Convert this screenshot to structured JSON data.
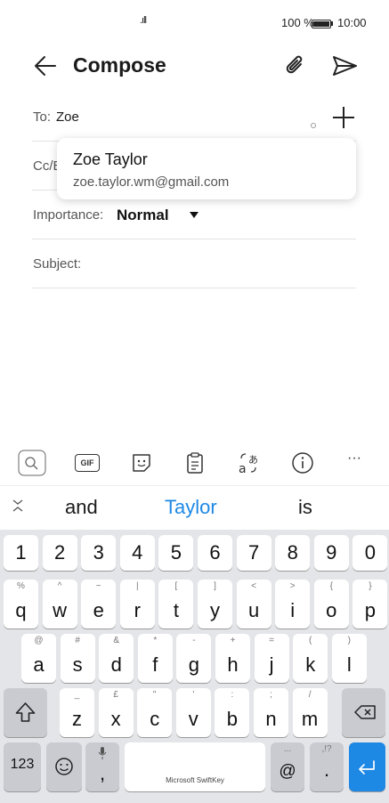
{
  "status_bar": {
    "signal": ".ıll",
    "battery": "100 %",
    "time": "10:00"
  },
  "header": {
    "title": "Compose"
  },
  "to": {
    "label": "To:",
    "value": "Zoe"
  },
  "cc": {
    "label": "Cc/B"
  },
  "importance": {
    "label": "Importance:",
    "value": "Normal"
  },
  "subject": {
    "label": "Subject:"
  },
  "suggestion": {
    "name": "Zoe Taylor",
    "email": "zoe.taylor.wm@gmail.com"
  },
  "keyboard_toolbar": {
    "gif": "GIF",
    "more": "···"
  },
  "predictions": {
    "left": "and",
    "center": "Taylor",
    "right": "is",
    "collapse": "⌄"
  },
  "keyboard": {
    "row_numbers": [
      "1",
      "2",
      "3",
      "4",
      "5",
      "6",
      "7",
      "8",
      "9",
      "0"
    ],
    "row_q": [
      {
        "k": "q",
        "s": "%"
      },
      {
        "k": "w",
        "s": "^"
      },
      {
        "k": "e",
        "s": "~"
      },
      {
        "k": "r",
        "s": "|"
      },
      {
        "k": "t",
        "s": "["
      },
      {
        "k": "y",
        "s": "]"
      },
      {
        "k": "u",
        "s": "<"
      },
      {
        "k": "i",
        "s": ">"
      },
      {
        "k": "o",
        "s": "{"
      },
      {
        "k": "p",
        "s": "}"
      }
    ],
    "row_a": [
      {
        "k": "a",
        "s": "@"
      },
      {
        "k": "s",
        "s": "#"
      },
      {
        "k": "d",
        "s": "&"
      },
      {
        "k": "f",
        "s": "*"
      },
      {
        "k": "g",
        "s": "-"
      },
      {
        "k": "h",
        "s": "+"
      },
      {
        "k": "j",
        "s": "="
      },
      {
        "k": "k",
        "s": "("
      },
      {
        "k": "l",
        "s": ")"
      }
    ],
    "row_z": [
      {
        "k": "z",
        "s": "_"
      },
      {
        "k": "x",
        "s": "£"
      },
      {
        "k": "c",
        "s": "\""
      },
      {
        "k": "v",
        "s": "'"
      },
      {
        "k": "b",
        "s": ":"
      },
      {
        "k": "n",
        "s": ";"
      },
      {
        "k": "m",
        "s": "/"
      }
    ],
    "numbers_key": "123",
    "comma_key": ",",
    "space_label": "Microsoft SwiftKey",
    "at_key": "@",
    "at_sub": "...",
    "period_key": ".",
    "period_sub": ",!?"
  },
  "colors": {
    "accent": "#1e88e5",
    "keyboard_bg": "#e4e5e9"
  }
}
